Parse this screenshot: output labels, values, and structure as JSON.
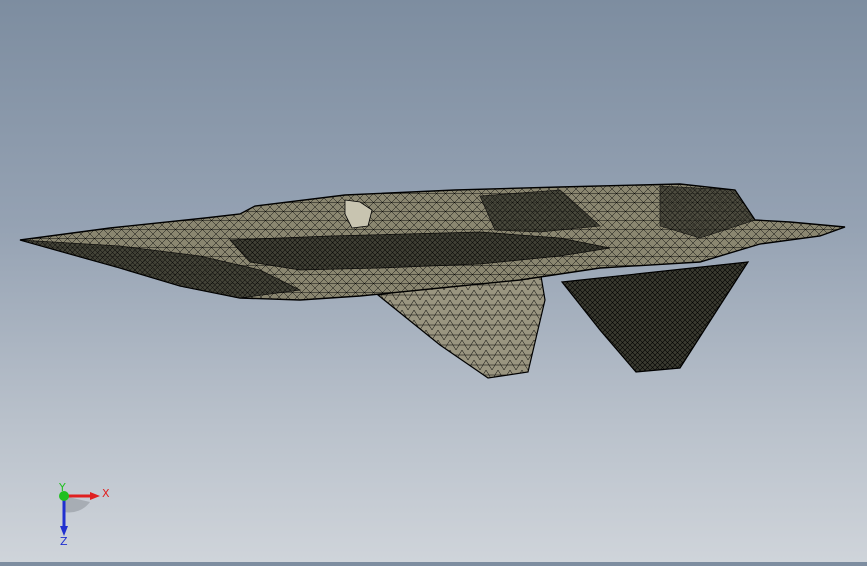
{
  "viewport": {
    "model": "aircraft-wireframe",
    "background_top": "#7d8da0",
    "background_bottom": "#cfd4da",
    "mesh_fill": "#8a8670",
    "mesh_line": "#000000"
  },
  "triad": {
    "x_label": "X",
    "y_label": "Y",
    "z_label": "Z",
    "x_color": "#e02020",
    "y_color": "#20c020",
    "z_color": "#2030d0"
  }
}
